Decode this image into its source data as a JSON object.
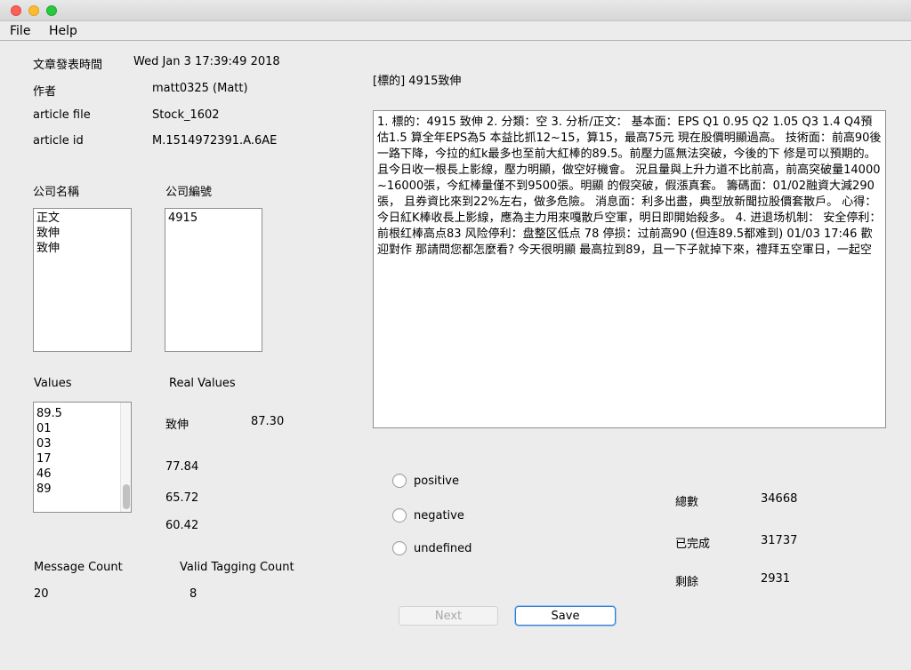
{
  "menu": {
    "file": "File",
    "help": "Help"
  },
  "meta": {
    "time_label": "文章發表時間",
    "time_value": "Wed Jan  3 17:39:49 2018",
    "author_label": "作者",
    "author_value": "matt0325 (Matt)",
    "file_label": "article file",
    "file_value": "Stock_1602",
    "id_label": "article id",
    "id_value": "M.1514972391.A.6AE"
  },
  "company": {
    "name_label": "公司名稱",
    "code_label": "公司編號",
    "names": [
      "正文",
      "致伸",
      "致伸"
    ],
    "codes": [
      "4915"
    ]
  },
  "values": {
    "label": "Values",
    "real_label": "Real Values",
    "items": [
      "89.5",
      "01",
      "03",
      "17",
      "46",
      "89"
    ],
    "real_name": "致伸",
    "real_items": [
      "87.30",
      "77.84",
      "65.72",
      "60.42"
    ]
  },
  "counts": {
    "message_label": "Message Count",
    "message_value": "20",
    "valid_label": "Valid Tagging Count",
    "valid_value": "8"
  },
  "article": {
    "title": "[標的] 4915致伸",
    "body": "1. 標的：4915 致伸 2. 分類：空 3. 分析/正文： 基本面：EPS Q1 0.95 Q2 1.05 Q3 1.4 Q4預估1.5 算全年EPS為5 本益比抓12~15，算15，最高75元 現在股價明顯過高。 技術面：前高90後一路下降，今拉的紅k最多也至前大紅棒的89.5。前壓力區無法突破，今後的下 修是可以預期的。 且今日收一根長上影線，壓力明顯，做空好機會。 況且量與上升力道不比前高，前高突破量14000~16000張，今紅棒量僅不到9500張。明顯 的假突破，假漲真套。 籌碼面：01/02融資大減290張， 且券資比來到22%左右，做多危險。 消息面：利多出盡，典型放新聞拉股價套散戶。 心得：今日紅K棒收長上影線，應為主力用來嘎散戶空軍，明日即開始殺多。 4. 进退场机制： 安全停利：前根红棒高点83 风险停利：盘整区低点 78 停损：过前高90 (但连89.5都难到) 01/03 17:46 歡迎對作 那請問您都怎麼看? 今天很明顯 最高拉到89，且一下子就掉下來，禮拜五空軍日，一起空"
  },
  "sentiment": {
    "positive": "positive",
    "negative": "negative",
    "undefined": "undefined"
  },
  "stats": {
    "total_label": "總數",
    "total_value": "34668",
    "done_label": "已完成",
    "done_value": "31737",
    "left_label": "剩餘",
    "left_value": "2931"
  },
  "buttons": {
    "next": "Next",
    "save": "Save"
  }
}
